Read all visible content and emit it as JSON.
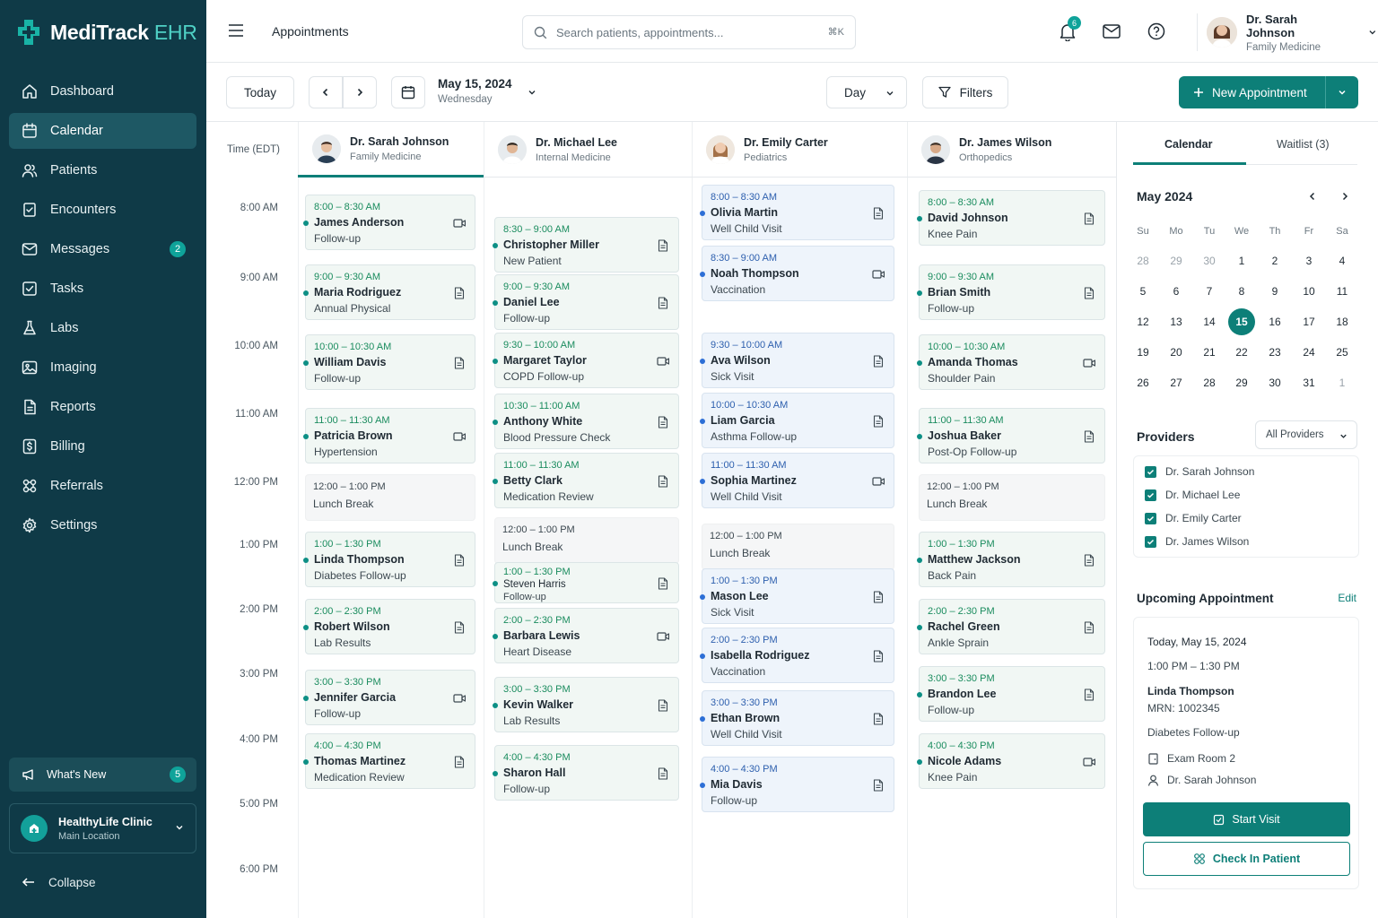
{
  "app": {
    "name_main": "MediTrack",
    "name_accent": " EHR"
  },
  "colors": {
    "sidebar": "#0f3a47",
    "accent": "#0d7f78",
    "badge": "#0fa39a",
    "appt_green": "#f1f7f4",
    "appt_blue": "#eef4fb"
  },
  "sidebar": {
    "items": [
      {
        "label": "Dashboard",
        "icon": "home-icon"
      },
      {
        "label": "Calendar",
        "icon": "calendar-icon",
        "active": true
      },
      {
        "label": "Patients",
        "icon": "users-icon"
      },
      {
        "label": "Encounters",
        "icon": "clipboard-icon"
      },
      {
        "label": "Messages",
        "icon": "mail-icon",
        "badge": "2"
      },
      {
        "label": "Tasks",
        "icon": "checkbox-icon"
      },
      {
        "label": "Labs",
        "icon": "flask-icon"
      },
      {
        "label": "Imaging",
        "icon": "image-icon"
      },
      {
        "label": "Reports",
        "icon": "report-icon"
      },
      {
        "label": "Billing",
        "icon": "dollar-icon"
      },
      {
        "label": "Referrals",
        "icon": "share-icon"
      },
      {
        "label": "Settings",
        "icon": "gear-icon"
      }
    ],
    "whats_new": {
      "label": "What's New",
      "badge": "5"
    },
    "clinic": {
      "name": "HealthyLife Clinic",
      "location": "Main Location"
    },
    "collapse_label": "Collapse"
  },
  "topbar": {
    "page_title": "Appointments",
    "search_placeholder": "Search patients, appointments...",
    "search_shortcut": "⌘K",
    "notification_count": "6",
    "user": {
      "name": "Dr. Sarah Johnson",
      "role": "Family Medicine"
    }
  },
  "toolbar": {
    "today_label": "Today",
    "date": "May 15, 2024",
    "weekday": "Wednesday",
    "view": "Day",
    "filters_label": "Filters",
    "new_appointment_label": "New Appointment"
  },
  "calendar": {
    "time_header": "Time (EDT)",
    "times": [
      "8:00 AM",
      "9:00 AM",
      "10:00 AM",
      "11:00 AM",
      "12:00 PM",
      "1:00 PM",
      "2:00 PM",
      "3:00 PM",
      "4:00 PM",
      "5:00 PM",
      "6:00 PM"
    ],
    "providers": [
      {
        "name": "Dr. Sarah Johnson",
        "specialty": "Family Medicine",
        "appointments": [
          {
            "time": "8:00 – 8:30 AM",
            "patient": "James Anderson",
            "reason": "Follow-up",
            "icon": "video"
          },
          {
            "time": "9:00 – 9:30 AM",
            "patient": "Maria Rodriguez",
            "reason": "Annual Physical",
            "icon": "doc"
          },
          {
            "time": "10:00 – 10:30 AM",
            "patient": "William Davis",
            "reason": "Follow-up",
            "icon": "doc"
          },
          {
            "time": "11:00 – 11:30 AM",
            "patient": "Patricia Brown",
            "reason": "Hypertension",
            "icon": "video"
          },
          {
            "time": "12:00 – 1:00 PM",
            "patient": "",
            "reason": "Lunch Break",
            "icon": "none",
            "kind": "break"
          },
          {
            "time": "1:00 – 1:30 PM",
            "patient": "Linda Thompson",
            "reason": "Diabetes Follow-up",
            "icon": "doc"
          },
          {
            "time": "2:00 – 2:30 PM",
            "patient": "Robert Wilson",
            "reason": "Lab Results",
            "icon": "doc"
          },
          {
            "time": "3:00 – 3:30 PM",
            "patient": "Jennifer Garcia",
            "reason": "Follow-up",
            "icon": "video"
          },
          {
            "time": "4:00 – 4:30 PM",
            "patient": "Thomas Martinez",
            "reason": "Medication Review",
            "icon": "doc"
          }
        ]
      },
      {
        "name": "Dr. Michael Lee",
        "specialty": "Internal Medicine",
        "appointments": [
          {
            "time": "8:30 – 9:00 AM",
            "patient": "Christopher Miller",
            "reason": "New Patient",
            "icon": "doc"
          },
          {
            "time": "9:00 – 9:30 AM",
            "patient": "Daniel Lee",
            "reason": "Follow-up",
            "icon": "doc"
          },
          {
            "time": "9:30 – 10:00 AM",
            "patient": "Margaret Taylor",
            "reason": "COPD Follow-up",
            "icon": "video"
          },
          {
            "time": "10:30 – 11:00 AM",
            "patient": "Anthony White",
            "reason": "Blood Pressure Check",
            "icon": "doc"
          },
          {
            "time": "11:00 – 11:30 AM",
            "patient": "Betty Clark",
            "reason": "Medication Review",
            "icon": "doc"
          },
          {
            "time": "12:00 – 1:00 PM",
            "patient": "",
            "reason": "Lunch Break",
            "icon": "none",
            "kind": "break"
          },
          {
            "time": "1:00 – 1:30 PM",
            "patient": "Steven Harris",
            "reason": "Follow-up",
            "icon": "doc",
            "kind": "small"
          },
          {
            "time": "2:00 – 2:30 PM",
            "patient": "Barbara Lewis",
            "reason": "Heart Disease",
            "icon": "video"
          },
          {
            "time": "3:00 – 3:30 PM",
            "patient": "Kevin Walker",
            "reason": "Lab Results",
            "icon": "doc"
          },
          {
            "time": "4:00 – 4:30 PM",
            "patient": "Sharon Hall",
            "reason": "Follow-up",
            "icon": "doc"
          }
        ]
      },
      {
        "name": "Dr. Emily Carter",
        "specialty": "Pediatrics",
        "appointments": [
          {
            "time": "8:00 – 8:30 AM",
            "patient": "Olivia Martin",
            "reason": "Well Child Visit",
            "icon": "doc"
          },
          {
            "time": "8:30 – 9:00 AM",
            "patient": "Noah Thompson",
            "reason": "Vaccination",
            "icon": "video"
          },
          {
            "time": "9:30 – 10:00 AM",
            "patient": "Ava Wilson",
            "reason": "Sick Visit",
            "icon": "doc"
          },
          {
            "time": "10:00 – 10:30 AM",
            "patient": "Liam Garcia",
            "reason": "Asthma Follow-up",
            "icon": "doc"
          },
          {
            "time": "11:00 – 11:30 AM",
            "patient": "Sophia Martinez",
            "reason": "Well Child Visit",
            "icon": "video"
          },
          {
            "time": "12:00 – 1:00 PM",
            "patient": "",
            "reason": "Lunch Break",
            "icon": "none",
            "kind": "break"
          },
          {
            "time": "1:00 – 1:30 PM",
            "patient": "Mason Lee",
            "reason": "Sick Visit",
            "icon": "doc"
          },
          {
            "time": "2:00 – 2:30 PM",
            "patient": "Isabella Rodriguez",
            "reason": "Vaccination",
            "icon": "doc"
          },
          {
            "time": "3:00 – 3:30 PM",
            "patient": "Ethan Brown",
            "reason": "Well Child Visit",
            "icon": "doc"
          },
          {
            "time": "4:00 – 4:30 PM",
            "patient": "Mia Davis",
            "reason": "Follow-up",
            "icon": "doc"
          }
        ]
      },
      {
        "name": "Dr. James Wilson",
        "specialty": "Orthopedics",
        "appointments": [
          {
            "time": "8:00 – 8:30 AM",
            "patient": "David Johnson",
            "reason": "Knee Pain",
            "icon": "doc"
          },
          {
            "time": "9:00 – 9:30 AM",
            "patient": "Brian Smith",
            "reason": "Follow-up",
            "icon": "doc"
          },
          {
            "time": "10:00 – 10:30 AM",
            "patient": "Amanda Thomas",
            "reason": "Shoulder Pain",
            "icon": "video"
          },
          {
            "time": "11:00 – 11:30 AM",
            "patient": "Joshua Baker",
            "reason": "Post-Op Follow-up",
            "icon": "doc"
          },
          {
            "time": "12:00 – 1:00 PM",
            "patient": "",
            "reason": "Lunch Break",
            "icon": "none",
            "kind": "break"
          },
          {
            "time": "1:00 – 1:30 PM",
            "patient": "Matthew Jackson",
            "reason": "Back Pain",
            "icon": "doc"
          },
          {
            "time": "2:00 – 2:30 PM",
            "patient": "Rachel Green",
            "reason": "Ankle Sprain",
            "icon": "doc"
          },
          {
            "time": "3:00 – 3:30 PM",
            "patient": "Brandon Lee",
            "reason": "Follow-up",
            "icon": "doc"
          },
          {
            "time": "4:00 – 4:30 PM",
            "patient": "Nicole Adams",
            "reason": "Knee Pain",
            "icon": "video"
          }
        ]
      }
    ]
  },
  "right_panel": {
    "tabs": [
      "Calendar",
      "Waitlist (3)"
    ],
    "mini_calendar": {
      "month": "May 2024",
      "weekdays": [
        "Su",
        "Mo",
        "Tu",
        "We",
        "Th",
        "Fr",
        "Sa"
      ],
      "weeks": [
        [
          "28",
          "29",
          "30",
          "1",
          "2",
          "3",
          "4"
        ],
        [
          "5",
          "6",
          "7",
          "8",
          "9",
          "10",
          "11"
        ],
        [
          "12",
          "13",
          "14",
          "15",
          "16",
          "17",
          "18"
        ],
        [
          "19",
          "20",
          "21",
          "22",
          "23",
          "24",
          "25"
        ],
        [
          "26",
          "27",
          "28",
          "29",
          "30",
          "31",
          "1"
        ]
      ],
      "selected": "15"
    },
    "providers_title": "Providers",
    "providers_filter": "All Providers",
    "provider_checks": [
      "Dr. Sarah Johnson",
      "Dr. Michael Lee",
      "Dr. Emily Carter",
      "Dr. James Wilson"
    ],
    "upcoming": {
      "title": "Upcoming Appointment",
      "edit_label": "Edit",
      "date": "Today, May 15, 2024",
      "time": "1:00 PM – 1:30 PM",
      "patient": "Linda Thompson",
      "mrn": "MRN: 1002345",
      "reason": "Diabetes Follow-up",
      "room": "Exam Room 2",
      "provider": "Dr. Sarah Johnson",
      "start_label": "Start Visit",
      "checkin_label": "Check In Patient"
    }
  }
}
